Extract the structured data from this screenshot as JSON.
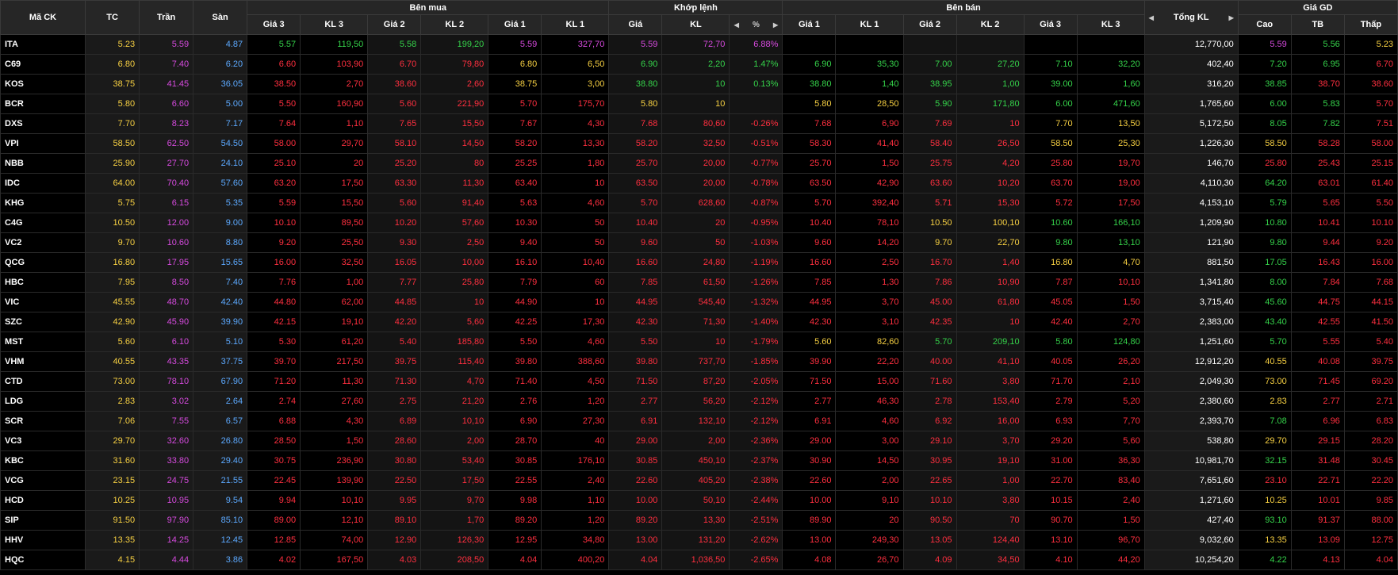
{
  "headers": {
    "symbol": "Mã CK",
    "ref": "TC",
    "ceil": "Trần",
    "floor": "Sàn",
    "buy_group": "Bên mua",
    "match_group": "Khớp lệnh",
    "sell_group": "Bên bán",
    "total": "Tổng KL",
    "price_group": "Giá GD",
    "p3": "Giá 3",
    "v3": "KL 3",
    "p2": "Giá 2",
    "v2": "KL 2",
    "p1": "Giá 1",
    "v1": "KL 1",
    "m_price": "Giá",
    "m_vol": "KL",
    "m_pct": "%",
    "high": "Cao",
    "avg": "TB",
    "low": "Thấp"
  },
  "icons": {
    "left": "◀",
    "right": "▶",
    "sort": "▲▼"
  },
  "colors": {
    "ceil": "#d64ade",
    "floor": "#5ca9ff",
    "ref": "#f7d042",
    "up": "#35d24a",
    "down": "#ff2f3f",
    "neutral": "#ffffff"
  },
  "rows": [
    {
      "s": "ITA",
      "c": "p",
      "tc": "5.23",
      "tran": "5.59",
      "san": "4.87",
      "b3": "5.57",
      "b3c": "g",
      "bv3": "119,50",
      "b2": "5.58",
      "b2c": "g",
      "bv2": "199,20",
      "b1": "5.59",
      "b1c": "p",
      "bv1": "327,70",
      "mp": "5.59",
      "mpc": "p",
      "mv": "72,70",
      "pct": "6.88%",
      "s1": "",
      "s1c": "n",
      "sv1": "",
      "s2": "",
      "s2c": "n",
      "sv2": "",
      "s3": "",
      "s3c": "n",
      "sv3": "",
      "tot": "12,770,00",
      "hi": "5.59",
      "hic": "p",
      "av": "5.56",
      "avc": "g",
      "lo": "5.23",
      "loc": "y"
    },
    {
      "s": "C69",
      "c": "g",
      "tc": "6.80",
      "tran": "7.40",
      "san": "6.20",
      "b3": "6.60",
      "b3c": "r",
      "bv3": "103,90",
      "b2": "6.70",
      "b2c": "r",
      "bv2": "79,80",
      "b1": "6.80",
      "b1c": "y",
      "bv1": "6,50",
      "mp": "6.90",
      "mpc": "g",
      "mv": "2,20",
      "pct": "1.47%",
      "s1": "6.90",
      "s1c": "g",
      "sv1": "35,30",
      "s2": "7.00",
      "s2c": "g",
      "sv2": "27,20",
      "s3": "7.10",
      "s3c": "g",
      "sv3": "32,20",
      "tot": "402,40",
      "hi": "7.20",
      "hic": "g",
      "av": "6.95",
      "avc": "g",
      "lo": "6.70",
      "loc": "r"
    },
    {
      "s": "KOS",
      "c": "g",
      "tc": "38.75",
      "tran": "41.45",
      "san": "36.05",
      "b3": "38.50",
      "b3c": "r",
      "bv3": "2,70",
      "b2": "38.60",
      "b2c": "r",
      "bv2": "2,60",
      "b1": "38.75",
      "b1c": "y",
      "bv1": "3,00",
      "mp": "38.80",
      "mpc": "g",
      "mv": "10",
      "pct": "0.13%",
      "s1": "38.80",
      "s1c": "g",
      "sv1": "1,40",
      "s2": "38.95",
      "s2c": "g",
      "sv2": "1,00",
      "s3": "39.00",
      "s3c": "g",
      "sv3": "1,60",
      "tot": "316,20",
      "hi": "38.85",
      "hic": "g",
      "av": "38.70",
      "avc": "r",
      "lo": "38.60",
      "loc": "r"
    },
    {
      "s": "BCR",
      "c": "y",
      "tc": "5.80",
      "tran": "6.60",
      "san": "5.00",
      "b3": "5.50",
      "b3c": "r",
      "bv3": "160,90",
      "b2": "5.60",
      "b2c": "r",
      "bv2": "221,90",
      "b1": "5.70",
      "b1c": "r",
      "bv1": "175,70",
      "mp": "5.80",
      "mpc": "y",
      "mv": "10",
      "pct": "",
      "s1": "5.80",
      "s1c": "y",
      "sv1": "28,50",
      "s2": "5.90",
      "s2c": "g",
      "sv2": "171,80",
      "s3": "6.00",
      "s3c": "g",
      "sv3": "471,60",
      "tot": "1,765,60",
      "hi": "6.00",
      "hic": "g",
      "av": "5.83",
      "avc": "g",
      "lo": "5.70",
      "loc": "r"
    },
    {
      "s": "DXS",
      "c": "r",
      "tc": "7.70",
      "tran": "8.23",
      "san": "7.17",
      "b3": "7.64",
      "b3c": "r",
      "bv3": "1,10",
      "b2": "7.65",
      "b2c": "r",
      "bv2": "15,50",
      "b1": "7.67",
      "b1c": "r",
      "bv1": "4,30",
      "mp": "7.68",
      "mpc": "r",
      "mv": "80,60",
      "pct": "-0.26%",
      "s1": "7.68",
      "s1c": "r",
      "sv1": "6,90",
      "s2": "7.69",
      "s2c": "r",
      "sv2": "10",
      "s3": "7.70",
      "s3c": "y",
      "sv3": "13,50",
      "tot": "5,172,50",
      "hi": "8.05",
      "hic": "g",
      "av": "7.82",
      "avc": "g",
      "lo": "7.51",
      "loc": "r"
    },
    {
      "s": "VPI",
      "c": "r",
      "tc": "58.50",
      "tran": "62.50",
      "san": "54.50",
      "b3": "58.00",
      "b3c": "r",
      "bv3": "29,70",
      "b2": "58.10",
      "b2c": "r",
      "bv2": "14,50",
      "b1": "58.20",
      "b1c": "r",
      "bv1": "13,30",
      "mp": "58.20",
      "mpc": "r",
      "mv": "32,50",
      "pct": "-0.51%",
      "s1": "58.30",
      "s1c": "r",
      "sv1": "41,40",
      "s2": "58.40",
      "s2c": "r",
      "sv2": "26,50",
      "s3": "58.50",
      "s3c": "y",
      "sv3": "25,30",
      "tot": "1,226,30",
      "hi": "58.50",
      "hic": "y",
      "av": "58.28",
      "avc": "r",
      "lo": "58.00",
      "loc": "r"
    },
    {
      "s": "NBB",
      "c": "r",
      "tc": "25.90",
      "tran": "27.70",
      "san": "24.10",
      "b3": "25.10",
      "b3c": "r",
      "bv3": "20",
      "b2": "25.20",
      "b2c": "r",
      "bv2": "80",
      "b1": "25.25",
      "b1c": "r",
      "bv1": "1,80",
      "mp": "25.70",
      "mpc": "r",
      "mv": "20,00",
      "pct": "-0.77%",
      "s1": "25.70",
      "s1c": "r",
      "sv1": "1,50",
      "s2": "25.75",
      "s2c": "r",
      "sv2": "4,20",
      "s3": "25.80",
      "s3c": "r",
      "sv3": "19,70",
      "tot": "146,70",
      "hi": "25.80",
      "hic": "r",
      "av": "25.43",
      "avc": "r",
      "lo": "25.15",
      "loc": "r"
    },
    {
      "s": "IDC",
      "c": "r",
      "tc": "64.00",
      "tran": "70.40",
      "san": "57.60",
      "b3": "63.20",
      "b3c": "r",
      "bv3": "17,50",
      "b2": "63.30",
      "b2c": "r",
      "bv2": "11,30",
      "b1": "63.40",
      "b1c": "r",
      "bv1": "10",
      "mp": "63.50",
      "mpc": "r",
      "mv": "20,00",
      "pct": "-0.78%",
      "s1": "63.50",
      "s1c": "r",
      "sv1": "42,90",
      "s2": "63.60",
      "s2c": "r",
      "sv2": "10,20",
      "s3": "63.70",
      "s3c": "r",
      "sv3": "19,00",
      "tot": "4,110,30",
      "hi": "64.20",
      "hic": "g",
      "av": "63.01",
      "avc": "r",
      "lo": "61.40",
      "loc": "r"
    },
    {
      "s": "KHG",
      "c": "r",
      "tc": "5.75",
      "tran": "6.15",
      "san": "5.35",
      "b3": "5.59",
      "b3c": "r",
      "bv3": "15,50",
      "b2": "5.60",
      "b2c": "r",
      "bv2": "91,40",
      "b1": "5.63",
      "b1c": "r",
      "bv1": "4,60",
      "mp": "5.70",
      "mpc": "r",
      "mv": "628,60",
      "pct": "-0.87%",
      "s1": "5.70",
      "s1c": "r",
      "sv1": "392,40",
      "s2": "5.71",
      "s2c": "r",
      "sv2": "15,30",
      "s3": "5.72",
      "s3c": "r",
      "sv3": "17,50",
      "tot": "4,153,10",
      "hi": "5.79",
      "hic": "g",
      "av": "5.65",
      "avc": "r",
      "lo": "5.50",
      "loc": "r"
    },
    {
      "s": "C4G",
      "c": "r",
      "tc": "10.50",
      "tran": "12.00",
      "san": "9.00",
      "b3": "10.10",
      "b3c": "r",
      "bv3": "89,50",
      "b2": "10.20",
      "b2c": "r",
      "bv2": "57,60",
      "b1": "10.30",
      "b1c": "r",
      "bv1": "50",
      "mp": "10.40",
      "mpc": "r",
      "mv": "20",
      "pct": "-0.95%",
      "s1": "10.40",
      "s1c": "r",
      "sv1": "78,10",
      "s2": "10.50",
      "s2c": "y",
      "sv2": "100,10",
      "s3": "10.60",
      "s3c": "g",
      "sv3": "166,10",
      "tot": "1,209,90",
      "hi": "10.80",
      "hic": "g",
      "av": "10.41",
      "avc": "r",
      "lo": "10.10",
      "loc": "r"
    },
    {
      "s": "VC2",
      "c": "r",
      "tc": "9.70",
      "tran": "10.60",
      "san": "8.80",
      "b3": "9.20",
      "b3c": "r",
      "bv3": "25,50",
      "b2": "9.30",
      "b2c": "r",
      "bv2": "2,50",
      "b1": "9.40",
      "b1c": "r",
      "bv1": "50",
      "mp": "9.60",
      "mpc": "r",
      "mv": "50",
      "pct": "-1.03%",
      "s1": "9.60",
      "s1c": "r",
      "sv1": "14,20",
      "s2": "9.70",
      "s2c": "y",
      "sv2": "22,70",
      "s3": "9.80",
      "s3c": "g",
      "sv3": "13,10",
      "tot": "121,90",
      "hi": "9.80",
      "hic": "g",
      "av": "9.44",
      "avc": "r",
      "lo": "9.20",
      "loc": "r"
    },
    {
      "s": "QCG",
      "c": "r",
      "tc": "16.80",
      "tran": "17.95",
      "san": "15.65",
      "b3": "16.00",
      "b3c": "r",
      "bv3": "32,50",
      "b2": "16.05",
      "b2c": "r",
      "bv2": "10,00",
      "b1": "16.10",
      "b1c": "r",
      "bv1": "10,40",
      "mp": "16.60",
      "mpc": "r",
      "mv": "24,80",
      "pct": "-1.19%",
      "s1": "16.60",
      "s1c": "r",
      "sv1": "2,50",
      "s2": "16.70",
      "s2c": "r",
      "sv2": "1,40",
      "s3": "16.80",
      "s3c": "y",
      "sv3": "4,70",
      "tot": "881,50",
      "hi": "17.05",
      "hic": "g",
      "av": "16.43",
      "avc": "r",
      "lo": "16.00",
      "loc": "r"
    },
    {
      "s": "HBC",
      "c": "r",
      "tc": "7.95",
      "tran": "8.50",
      "san": "7.40",
      "b3": "7.76",
      "b3c": "r",
      "bv3": "1,00",
      "b2": "7.77",
      "b2c": "r",
      "bv2": "25,80",
      "b1": "7.79",
      "b1c": "r",
      "bv1": "60",
      "mp": "7.85",
      "mpc": "r",
      "mv": "61,50",
      "pct": "-1.26%",
      "s1": "7.85",
      "s1c": "r",
      "sv1": "1,30",
      "s2": "7.86",
      "s2c": "r",
      "sv2": "10,90",
      "s3": "7.87",
      "s3c": "r",
      "sv3": "10,10",
      "tot": "1,341,80",
      "hi": "8.00",
      "hic": "g",
      "av": "7.84",
      "avc": "r",
      "lo": "7.68",
      "loc": "r"
    },
    {
      "s": "VIC",
      "c": "r",
      "tc": "45.55",
      "tran": "48.70",
      "san": "42.40",
      "b3": "44.80",
      "b3c": "r",
      "bv3": "62,00",
      "b2": "44.85",
      "b2c": "r",
      "bv2": "10",
      "b1": "44.90",
      "b1c": "r",
      "bv1": "10",
      "mp": "44.95",
      "mpc": "r",
      "mv": "545,40",
      "pct": "-1.32%",
      "s1": "44.95",
      "s1c": "r",
      "sv1": "3,70",
      "s2": "45.00",
      "s2c": "r",
      "sv2": "61,80",
      "s3": "45.05",
      "s3c": "r",
      "sv3": "1,50",
      "tot": "3,715,40",
      "hi": "45.60",
      "hic": "g",
      "av": "44.75",
      "avc": "r",
      "lo": "44.15",
      "loc": "r"
    },
    {
      "s": "SZC",
      "c": "r",
      "tc": "42.90",
      "tran": "45.90",
      "san": "39.90",
      "b3": "42.15",
      "b3c": "r",
      "bv3": "19,10",
      "b2": "42.20",
      "b2c": "r",
      "bv2": "5,60",
      "b1": "42.25",
      "b1c": "r",
      "bv1": "17,30",
      "mp": "42.30",
      "mpc": "r",
      "mv": "71,30",
      "pct": "-1.40%",
      "s1": "42.30",
      "s1c": "r",
      "sv1": "3,10",
      "s2": "42.35",
      "s2c": "r",
      "sv2": "10",
      "s3": "42.40",
      "s3c": "r",
      "sv3": "2,70",
      "tot": "2,383,00",
      "hi": "43.40",
      "hic": "g",
      "av": "42.55",
      "avc": "r",
      "lo": "41.50",
      "loc": "r"
    },
    {
      "s": "MST",
      "c": "r",
      "tc": "5.60",
      "tran": "6.10",
      "san": "5.10",
      "b3": "5.30",
      "b3c": "r",
      "bv3": "61,20",
      "b2": "5.40",
      "b2c": "r",
      "bv2": "185,80",
      "b1": "5.50",
      "b1c": "r",
      "bv1": "4,60",
      "mp": "5.50",
      "mpc": "r",
      "mv": "10",
      "pct": "-1.79%",
      "s1": "5.60",
      "s1c": "y",
      "sv1": "82,60",
      "s2": "5.70",
      "s2c": "g",
      "sv2": "209,10",
      "s3": "5.80",
      "s3c": "g",
      "sv3": "124,80",
      "tot": "1,251,60",
      "hi": "5.70",
      "hic": "g",
      "av": "5.55",
      "avc": "r",
      "lo": "5.40",
      "loc": "r"
    },
    {
      "s": "VHM",
      "c": "r",
      "tc": "40.55",
      "tran": "43.35",
      "san": "37.75",
      "b3": "39.70",
      "b3c": "r",
      "bv3": "217,50",
      "b2": "39.75",
      "b2c": "r",
      "bv2": "115,40",
      "b1": "39.80",
      "b1c": "r",
      "bv1": "388,60",
      "mp": "39.80",
      "mpc": "r",
      "mv": "737,70",
      "pct": "-1.85%",
      "s1": "39.90",
      "s1c": "r",
      "sv1": "22,20",
      "s2": "40.00",
      "s2c": "r",
      "sv2": "41,10",
      "s3": "40.05",
      "s3c": "r",
      "sv3": "26,20",
      "tot": "12,912,20",
      "hi": "40.55",
      "hic": "y",
      "av": "40.08",
      "avc": "r",
      "lo": "39.75",
      "loc": "r"
    },
    {
      "s": "CTD",
      "c": "r",
      "tc": "73.00",
      "tran": "78.10",
      "san": "67.90",
      "b3": "71.20",
      "b3c": "r",
      "bv3": "11,30",
      "b2": "71.30",
      "b2c": "r",
      "bv2": "4,70",
      "b1": "71.40",
      "b1c": "r",
      "bv1": "4,50",
      "mp": "71.50",
      "mpc": "r",
      "mv": "87,20",
      "pct": "-2.05%",
      "s1": "71.50",
      "s1c": "r",
      "sv1": "15,00",
      "s2": "71.60",
      "s2c": "r",
      "sv2": "3,80",
      "s3": "71.70",
      "s3c": "r",
      "sv3": "2,10",
      "tot": "2,049,30",
      "hi": "73.00",
      "hic": "y",
      "av": "71.45",
      "avc": "r",
      "lo": "69.20",
      "loc": "r"
    },
    {
      "s": "LDG",
      "c": "r",
      "tc": "2.83",
      "tran": "3.02",
      "san": "2.64",
      "b3": "2.74",
      "b3c": "r",
      "bv3": "27,60",
      "b2": "2.75",
      "b2c": "r",
      "bv2": "21,20",
      "b1": "2.76",
      "b1c": "r",
      "bv1": "1,20",
      "mp": "2.77",
      "mpc": "r",
      "mv": "56,20",
      "pct": "-2.12%",
      "s1": "2.77",
      "s1c": "r",
      "sv1": "46,30",
      "s2": "2.78",
      "s2c": "r",
      "sv2": "153,40",
      "s3": "2.79",
      "s3c": "r",
      "sv3": "5,20",
      "tot": "2,380,60",
      "hi": "2.83",
      "hic": "y",
      "av": "2.77",
      "avc": "r",
      "lo": "2.71",
      "loc": "r"
    },
    {
      "s": "SCR",
      "c": "r",
      "tc": "7.06",
      "tran": "7.55",
      "san": "6.57",
      "b3": "6.88",
      "b3c": "r",
      "bv3": "4,30",
      "b2": "6.89",
      "b2c": "r",
      "bv2": "10,10",
      "b1": "6.90",
      "b1c": "r",
      "bv1": "27,30",
      "mp": "6.91",
      "mpc": "r",
      "mv": "132,10",
      "pct": "-2.12%",
      "s1": "6.91",
      "s1c": "r",
      "sv1": "4,60",
      "s2": "6.92",
      "s2c": "r",
      "sv2": "16,00",
      "s3": "6.93",
      "s3c": "r",
      "sv3": "7,70",
      "tot": "2,393,70",
      "hi": "7.08",
      "hic": "g",
      "av": "6.96",
      "avc": "r",
      "lo": "6.83",
      "loc": "r"
    },
    {
      "s": "VC3",
      "c": "r",
      "tc": "29.70",
      "tran": "32.60",
      "san": "26.80",
      "b3": "28.50",
      "b3c": "r",
      "bv3": "1,50",
      "b2": "28.60",
      "b2c": "r",
      "bv2": "2,00",
      "b1": "28.70",
      "b1c": "r",
      "bv1": "40",
      "mp": "29.00",
      "mpc": "r",
      "mv": "2,00",
      "pct": "-2.36%",
      "s1": "29.00",
      "s1c": "r",
      "sv1": "3,00",
      "s2": "29.10",
      "s2c": "r",
      "sv2": "3,70",
      "s3": "29.20",
      "s3c": "r",
      "sv3": "5,60",
      "tot": "538,80",
      "hi": "29.70",
      "hic": "y",
      "av": "29.15",
      "avc": "r",
      "lo": "28.20",
      "loc": "r"
    },
    {
      "s": "KBC",
      "c": "r",
      "tc": "31.60",
      "tran": "33.80",
      "san": "29.40",
      "b3": "30.75",
      "b3c": "r",
      "bv3": "236,90",
      "b2": "30.80",
      "b2c": "r",
      "bv2": "53,40",
      "b1": "30.85",
      "b1c": "r",
      "bv1": "176,10",
      "mp": "30.85",
      "mpc": "r",
      "mv": "450,10",
      "pct": "-2.37%",
      "s1": "30.90",
      "s1c": "r",
      "sv1": "14,50",
      "s2": "30.95",
      "s2c": "r",
      "sv2": "19,10",
      "s3": "31.00",
      "s3c": "r",
      "sv3": "36,30",
      "tot": "10,981,70",
      "hi": "32.15",
      "hic": "g",
      "av": "31.48",
      "avc": "r",
      "lo": "30.45",
      "loc": "r"
    },
    {
      "s": "VCG",
      "c": "r",
      "tc": "23.15",
      "tran": "24.75",
      "san": "21.55",
      "b3": "22.45",
      "b3c": "r",
      "bv3": "139,90",
      "b2": "22.50",
      "b2c": "r",
      "bv2": "17,50",
      "b1": "22.55",
      "b1c": "r",
      "bv1": "2,40",
      "mp": "22.60",
      "mpc": "r",
      "mv": "405,20",
      "pct": "-2.38%",
      "s1": "22.60",
      "s1c": "r",
      "sv1": "2,00",
      "s2": "22.65",
      "s2c": "r",
      "sv2": "1,00",
      "s3": "22.70",
      "s3c": "r",
      "sv3": "83,40",
      "tot": "7,651,60",
      "hi": "23.10",
      "hic": "r",
      "av": "22.71",
      "avc": "r",
      "lo": "22.20",
      "loc": "r"
    },
    {
      "s": "HCD",
      "c": "r",
      "tc": "10.25",
      "tran": "10.95",
      "san": "9.54",
      "b3": "9.94",
      "b3c": "r",
      "bv3": "10,10",
      "b2": "9.95",
      "b2c": "r",
      "bv2": "9,70",
      "b1": "9.98",
      "b1c": "r",
      "bv1": "1,10",
      "mp": "10.00",
      "mpc": "r",
      "mv": "50,10",
      "pct": "-2.44%",
      "s1": "10.00",
      "s1c": "r",
      "sv1": "9,10",
      "s2": "10.10",
      "s2c": "r",
      "sv2": "3,80",
      "s3": "10.15",
      "s3c": "r",
      "sv3": "2,40",
      "tot": "1,271,60",
      "hi": "10.25",
      "hic": "y",
      "av": "10.01",
      "avc": "r",
      "lo": "9.85",
      "loc": "r"
    },
    {
      "s": "SIP",
      "c": "r",
      "tc": "91.50",
      "tran": "97.90",
      "san": "85.10",
      "b3": "89.00",
      "b3c": "r",
      "bv3": "12,10",
      "b2": "89.10",
      "b2c": "r",
      "bv2": "1,70",
      "b1": "89.20",
      "b1c": "r",
      "bv1": "1,20",
      "mp": "89.20",
      "mpc": "r",
      "mv": "13,30",
      "pct": "-2.51%",
      "s1": "89.90",
      "s1c": "r",
      "sv1": "20",
      "s2": "90.50",
      "s2c": "r",
      "sv2": "70",
      "s3": "90.70",
      "s3c": "r",
      "sv3": "1,50",
      "tot": "427,40",
      "hi": "93.10",
      "hic": "g",
      "av": "91.37",
      "avc": "r",
      "lo": "88.00",
      "loc": "r"
    },
    {
      "s": "HHV",
      "c": "r",
      "tc": "13.35",
      "tran": "14.25",
      "san": "12.45",
      "b3": "12.85",
      "b3c": "r",
      "bv3": "74,00",
      "b2": "12.90",
      "b2c": "r",
      "bv2": "126,30",
      "b1": "12.95",
      "b1c": "r",
      "bv1": "34,80",
      "mp": "13.00",
      "mpc": "r",
      "mv": "131,20",
      "pct": "-2.62%",
      "s1": "13.00",
      "s1c": "r",
      "sv1": "249,30",
      "s2": "13.05",
      "s2c": "r",
      "sv2": "124,40",
      "s3": "13.10",
      "s3c": "r",
      "sv3": "96,70",
      "tot": "9,032,60",
      "hi": "13.35",
      "hic": "y",
      "av": "13.09",
      "avc": "r",
      "lo": "12.75",
      "loc": "r"
    },
    {
      "s": "HQC",
      "c": "r",
      "tc": "4.15",
      "tran": "4.44",
      "san": "3.86",
      "b3": "4.02",
      "b3c": "r",
      "bv3": "167,50",
      "b2": "4.03",
      "b2c": "r",
      "bv2": "208,50",
      "b1": "4.04",
      "b1c": "r",
      "bv1": "400,20",
      "mp": "4.04",
      "mpc": "r",
      "mv": "1,036,50",
      "pct": "-2.65%",
      "s1": "4.08",
      "s1c": "r",
      "sv1": "26,70",
      "s2": "4.09",
      "s2c": "r",
      "sv2": "34,50",
      "s3": "4.10",
      "s3c": "r",
      "sv3": "44,20",
      "tot": "10,254,20",
      "hi": "4.22",
      "hic": "g",
      "av": "4.13",
      "avc": "r",
      "lo": "4.04",
      "loc": "r"
    }
  ]
}
